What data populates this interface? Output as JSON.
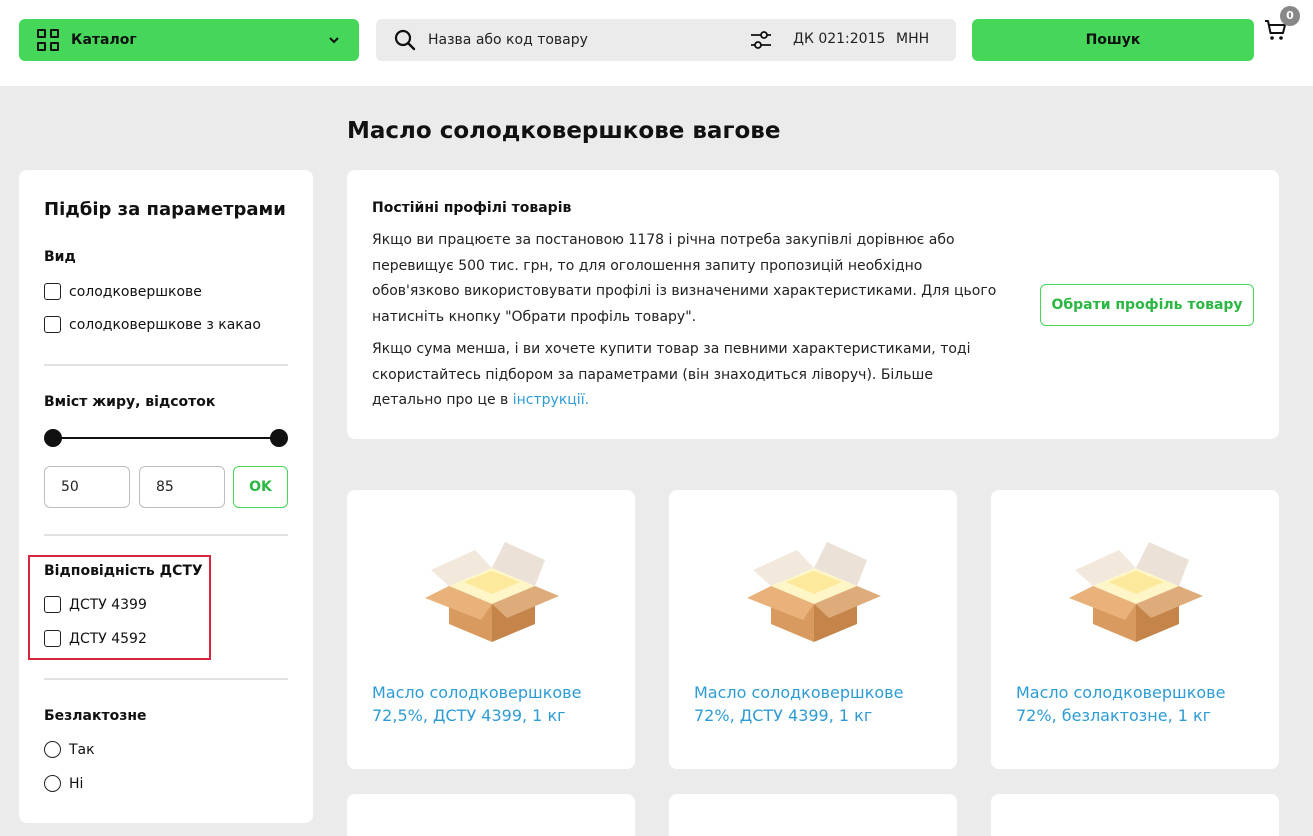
{
  "header": {
    "catalog_label": "Каталог",
    "search_placeholder": "Назва або код товару",
    "dk_label": "ДК 021:2015",
    "mnn_label": "МНН",
    "search_button": "Пошук",
    "cart_count": "0"
  },
  "page_title": "Масло солодковершкове вагове",
  "sidebar": {
    "title": "Підбір за параметрами",
    "kind": {
      "title": "Вид",
      "options": [
        "солодковершкове",
        "солодковершкове з какао"
      ]
    },
    "fat": {
      "title": "Вміст жиру, відсоток",
      "min": "50",
      "max": "85",
      "ok_label": "OK"
    },
    "dstu": {
      "title": "Відповідність ДСТУ",
      "options": [
        "ДСТУ 4399",
        "ДСТУ 4592"
      ]
    },
    "lactose": {
      "title": "Безлактозне",
      "options": [
        "Так",
        "Ні"
      ]
    }
  },
  "info": {
    "title": "Постійні профілі товарів",
    "para1": "Якщо ви працюєте за постановою 1178 і річна потреба закупівлі дорівнює або перевищує 500 тис. грн, то для оголошення запиту пропозицій необхідно обов'язково використовувати профілі із визначеними характеристиками. Для цього натисніть кнопку \"Обрати профіль товару\".",
    "para2": "Якщо сума менша, і ви хочете купити товар за певними характеристиками, тоді скористайтесь підбором за параметрами (він знаходиться ліворуч). Більше детально про це в",
    "link": "інструкції.",
    "profile_button": "Обрати профіль товару"
  },
  "products": [
    {
      "name": "Масло солодковершкове 72,5%, ДСТУ 4399, 1 кг",
      "icon": "box-icon"
    },
    {
      "name": "Масло солодковершкове 72%, ДСТУ 4399, 1 кг",
      "icon": "box-icon"
    },
    {
      "name": "Масло солодковершкове 72%, безлактозне, 1 кг",
      "icon": "box-icon"
    }
  ],
  "colors": {
    "accent": "#45d65a",
    "link": "#2d9bd4",
    "highlight": "#d7263d",
    "background": "#ebebeb"
  }
}
